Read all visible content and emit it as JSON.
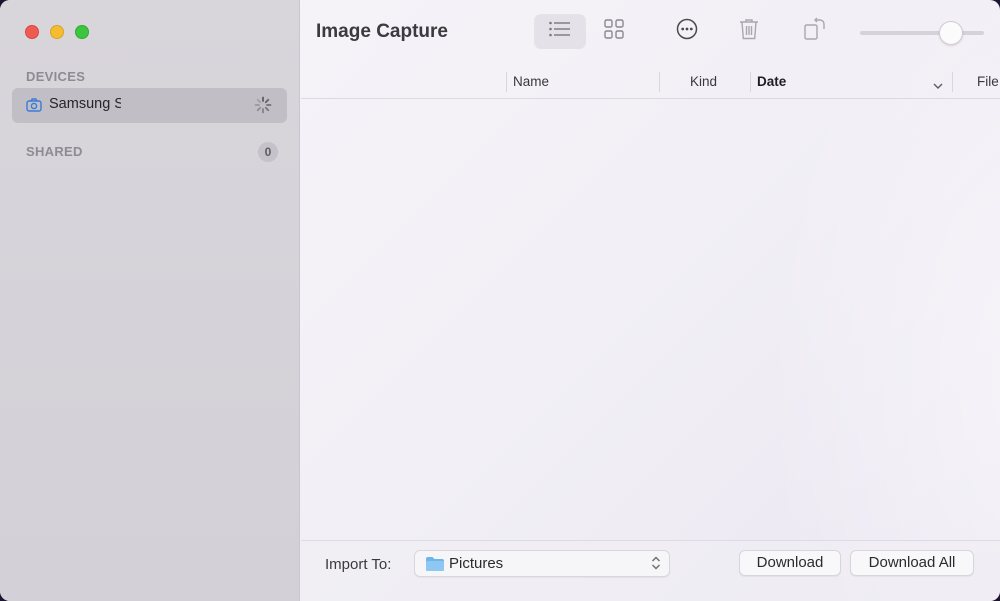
{
  "window": {
    "title": "Image Capture"
  },
  "sidebar": {
    "devices_label": "DEVICES",
    "devices": [
      {
        "name": "Samsung S",
        "icon": "camera-icon",
        "status": "loading"
      }
    ],
    "shared_label": "SHARED",
    "shared_count": "0"
  },
  "toolbar": {
    "view_mode": "list",
    "icons": [
      "list-view-icon",
      "grid-view-icon",
      "more-icon",
      "trash-icon",
      "rotate-icon"
    ],
    "zoom_level": 0.75
  },
  "columns": {
    "name": "Name",
    "kind": "Kind",
    "date": "Date",
    "file_size": "File Size",
    "sorted_by": "Date"
  },
  "bottom": {
    "import_label": "Import To:",
    "import_destination": "Pictures",
    "download_label": "Download",
    "download_all_label": "Download All"
  },
  "colors": {
    "accent_icon": "#3a7bd5",
    "folder": "#6fb5ea",
    "close": "#ee5b55",
    "minimize": "#f4bc2f",
    "zoom": "#3dc540"
  }
}
